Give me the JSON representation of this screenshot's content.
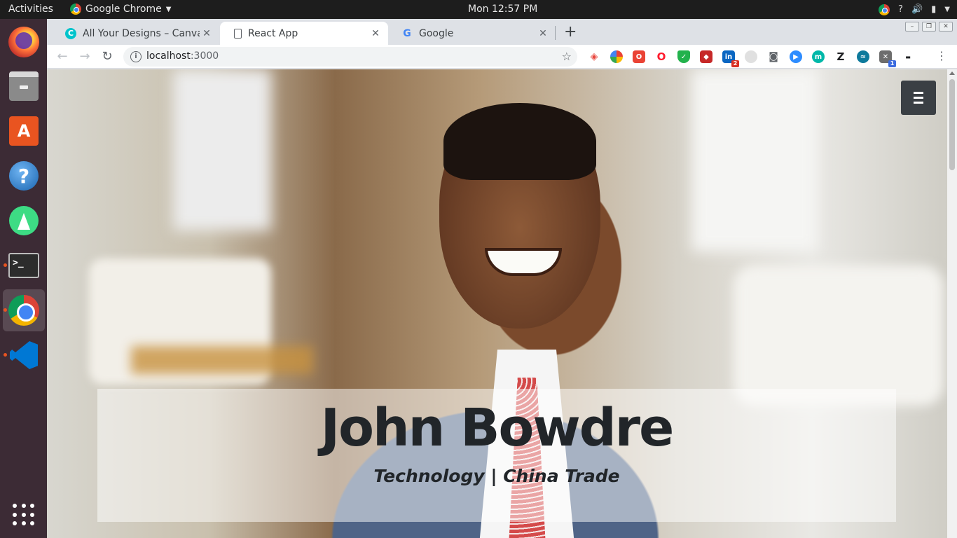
{
  "topbar": {
    "activities": "Activities",
    "app_name": "Google Chrome",
    "clock": "Mon 12:57 PM"
  },
  "dock": {
    "items": [
      {
        "name": "firefox",
        "running": false
      },
      {
        "name": "files",
        "running": false
      },
      {
        "name": "ubuntu-software",
        "running": false
      },
      {
        "name": "help",
        "running": false
      },
      {
        "name": "android-studio",
        "running": false
      },
      {
        "name": "terminal",
        "running": true
      },
      {
        "name": "chrome",
        "running": true,
        "active": true
      },
      {
        "name": "vscode",
        "running": true
      }
    ]
  },
  "browser": {
    "tabs": [
      {
        "title": "All Your Designs – Canva",
        "favicon": "canva-icon",
        "active": false
      },
      {
        "title": "React App",
        "favicon": "document-icon",
        "active": true
      },
      {
        "title": "Google",
        "favicon": "google-icon",
        "active": false
      }
    ],
    "url_host": "localhost",
    "url_port": ":3000",
    "extension_badges": {
      "linkedin": "2",
      "extension": "1"
    }
  },
  "page": {
    "hero": {
      "name": "John Bowdre",
      "tagline": "Technology | China Trade"
    }
  },
  "colors": {
    "topbar_bg": "#1d1d1d",
    "dock_bg": "#3c2b35",
    "running_dot": "#e95420",
    "menu_button_bg": "#3a3f44",
    "hero_text": "#212529"
  }
}
